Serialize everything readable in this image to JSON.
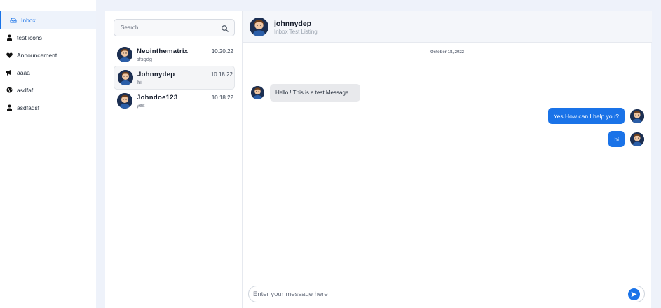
{
  "sidebar": {
    "items": [
      {
        "label": "Inbox",
        "icon": "inbox-icon",
        "active": true
      },
      {
        "label": "test icons",
        "icon": "user-icon"
      },
      {
        "label": "Announcement",
        "icon": "heart-icon"
      },
      {
        "label": "aaaa",
        "icon": "megaphone-icon"
      },
      {
        "label": "asdfaf",
        "icon": "globe-icon"
      },
      {
        "label": "asdfadsf",
        "icon": "user-icon"
      }
    ]
  },
  "search": {
    "placeholder": "Search",
    "value": ""
  },
  "conversations": [
    {
      "name": "Neointhematrix",
      "snippet": "sfsgdg",
      "date": "10.20.22"
    },
    {
      "name": "Johnnydep",
      "snippet": "hi",
      "date": "10.18.22",
      "selected": true
    },
    {
      "name": "Johndoe123",
      "snippet": "yes",
      "date": "10.18.22"
    }
  ],
  "chat": {
    "title": "johnnydep",
    "subtitle": "Inbox Test Listing",
    "date_separator": "October 18, 2022",
    "messages": [
      {
        "direction": "in",
        "text": "Hello ! This is a test Message...."
      },
      {
        "direction": "out",
        "text": "Yes How can I help you?"
      },
      {
        "direction": "out",
        "text": "hi"
      }
    ]
  },
  "composer": {
    "placeholder": "Enter your message here",
    "value": ""
  },
  "colors": {
    "accent": "#1a73e8",
    "frame": "#eef2fa",
    "bubble_in": "#e8e9ec"
  }
}
